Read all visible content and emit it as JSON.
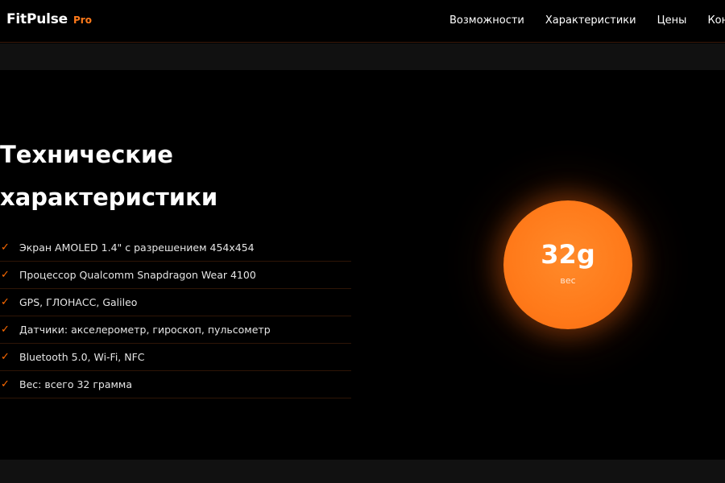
{
  "header": {
    "logo_main": "FitPulse",
    "logo_pro": "Pro",
    "nav": [
      "Возможности",
      "Характеристики",
      "Цены",
      "Контакты"
    ]
  },
  "section": {
    "title_line1": "Технические",
    "title_line2": "характеристики",
    "specs": [
      "Экран AMOLED 1.4\" с разрешением 454x454",
      "Процессор Qualcomm Snapdragon Wear 4100",
      "GPS, ГЛОНАСС, Galileo",
      "Датчики: акселерометр, гироскоп, пульсометр",
      "Bluetooth 5.0, Wi-Fi, NFC",
      "Вес: всего 32 грамма"
    ],
    "check_glyph": "✓"
  },
  "badge": {
    "value": "32g",
    "label": "вес"
  },
  "colors": {
    "accent": "#ff7a1a",
    "background": "#000000",
    "strip": "#111111"
  }
}
